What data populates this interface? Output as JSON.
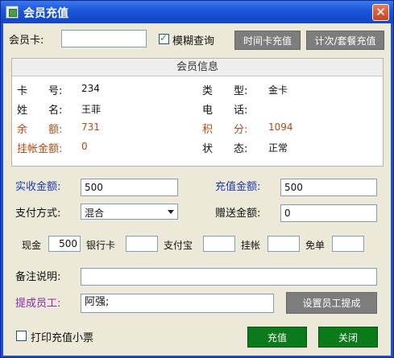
{
  "window": {
    "title": "会员充值",
    "close_glyph": "✕"
  },
  "top": {
    "card_label": "会员卡:",
    "card_value": "",
    "fuzzy_label": "模糊查询",
    "fuzzy_checked": true,
    "btn_time_card": "时间卡充值",
    "btn_count_package": "计次/套餐充值"
  },
  "info": {
    "header": "会员信息",
    "card_no_label": "卡　　号:",
    "card_no": "234",
    "type_label": "类　　型:",
    "type": "金卡",
    "name_label": "姓　　名:",
    "name": "王菲",
    "phone_label": "电　　话:",
    "phone": "",
    "balance_label": "余　　额:",
    "balance": "731",
    "points_label": "积　　分:",
    "points": "1094",
    "credit_label": "挂帐金额:",
    "credit": "0",
    "status_label": "状　　态:",
    "status": "正常"
  },
  "form": {
    "received_label": "实收金额:",
    "received": "500",
    "recharge_label": "充值金额:",
    "recharge": "500",
    "pay_label": "支付方式:",
    "pay_method": "混合",
    "gift_label": "赠送金额:",
    "gift": "0",
    "cash_label": "现金",
    "cash": "500",
    "bank_label": "银行卡",
    "bank": "",
    "alipay_label": "支付宝",
    "alipay": "",
    "onaccount_label": "挂帐",
    "onaccount": "",
    "free_label": "免单",
    "free": "",
    "remark_label": "备注说明:",
    "remark": "",
    "staff_label": "提成员工:",
    "staff": "阿强;",
    "btn_set_staff": "设置员工提成"
  },
  "footer": {
    "print_label": "打印充值小票",
    "print_checked": false,
    "btn_recharge": "充值",
    "btn_close": "关闭"
  },
  "colors": {
    "title_bar": "#1f55d8",
    "dialog_bg": "#ece9d8",
    "accent_blue": "#1a3bb0",
    "accent_orange": "#b04a10",
    "accent_purple": "#8a2ab0",
    "green_button": "#0a7a1a",
    "gray_button": "#7d7d7d"
  }
}
